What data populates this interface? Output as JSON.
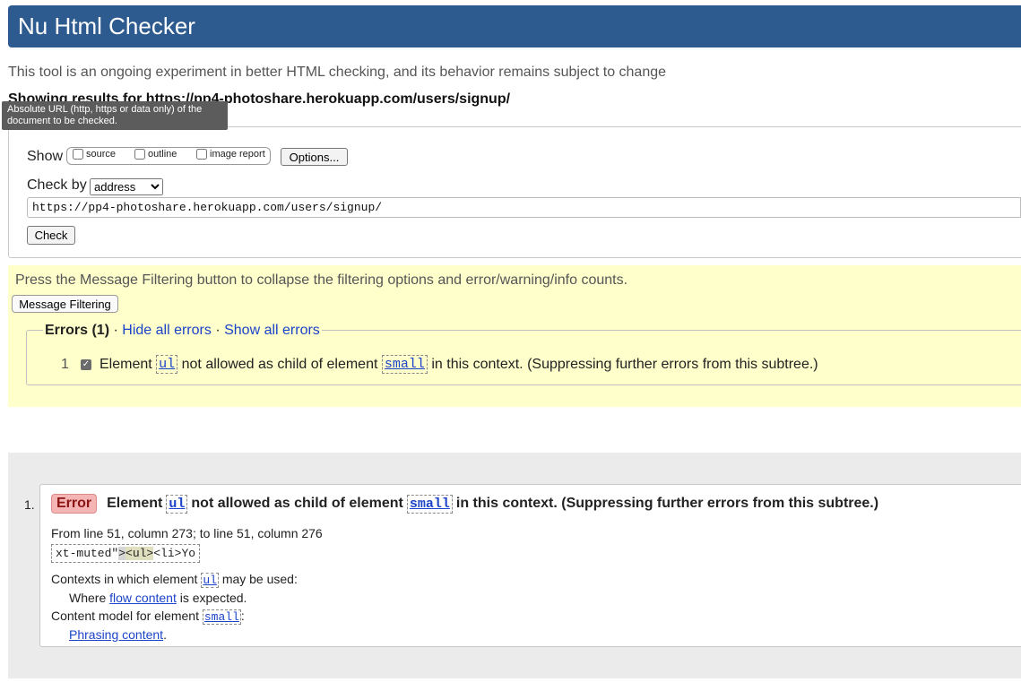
{
  "header": {
    "title": "Nu Html Checker"
  },
  "intro": "This tool is an ongoing experiment in better HTML checking, and its behavior remains subject to change",
  "showing": "Showing results for https://pp4-photoshare.herokuapp.com/users/signup/",
  "tooltip": "Absolute URL (http, https or data only) of the document to be checked.",
  "form": {
    "show_label": "Show",
    "show_options": [
      {
        "label": "source",
        "checked": false
      },
      {
        "label": "outline",
        "checked": false
      },
      {
        "label": "image report",
        "checked": false
      }
    ],
    "options_button": "Options...",
    "check_by_label": "Check by",
    "check_by_value": "address",
    "url_value": "https://pp4-photoshare.herokuapp.com/users/signup/",
    "check_button": "Check"
  },
  "filter": {
    "text": "Press the Message Filtering button to collapse the filtering options and error/warning/info counts.",
    "button": "Message Filtering",
    "legend_title": "Errors (1)",
    "separator": "·",
    "hide_all": "Hide all errors",
    "show_all": "Show all errors",
    "item": {
      "number": "1",
      "prefix": "Element",
      "code1": "ul",
      "middle": "not allowed as child of element",
      "code2": "small",
      "suffix": "in this context. (Suppressing further errors from this subtree.)"
    }
  },
  "result": {
    "number": "1.",
    "badge": "Error",
    "prefix": "Element",
    "code1": "ul",
    "middle": "not allowed as child of element",
    "code2": "small",
    "suffix": "in this context. (Suppressing further errors from this subtree.)",
    "location": "From line 51, column 273; to line 51, column 276",
    "extract": {
      "before": "xt-muted\"",
      "gt": ">",
      "hl": "<ul>",
      "after": "<li>Yo"
    },
    "contexts_prefix": "Contexts in which element",
    "contexts_code": "ul",
    "contexts_suffix": "may be used:",
    "where_prefix": "Where",
    "where_link": "flow content",
    "where_suffix": "is expected.",
    "model_prefix": "Content model for element",
    "model_code": "small",
    "model_suffix": ":",
    "phrasing_link": "Phrasing content",
    "phrasing_suffix": "."
  }
}
